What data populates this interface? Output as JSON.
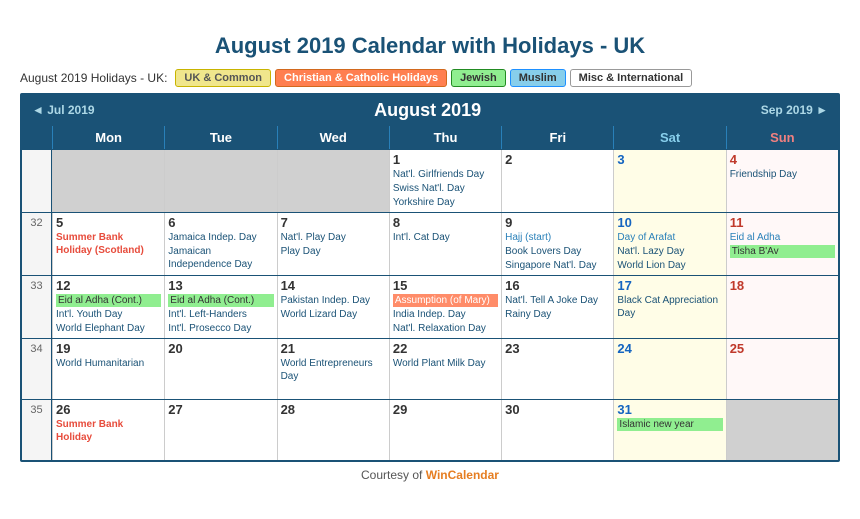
{
  "page": {
    "title": "August 2019 Calendar with Holidays - UK",
    "courtesy_text": "Courtesy of ",
    "courtesy_link": "WinCalendar"
  },
  "filters": {
    "label": "August 2019 Holidays - UK:",
    "buttons": [
      {
        "id": "uk",
        "label": "UK & Common",
        "class": "uk"
      },
      {
        "id": "christian",
        "label": "Christian & Catholic Holidays",
        "class": "christian"
      },
      {
        "id": "jewish",
        "label": "Jewish",
        "class": "jewish"
      },
      {
        "id": "muslim",
        "label": "Muslim",
        "class": "muslim"
      },
      {
        "id": "misc",
        "label": "Misc & International",
        "class": "misc"
      }
    ]
  },
  "calendar": {
    "month_title": "August 2019",
    "prev_label": "◄ Jul 2019",
    "next_label": "Sep 2019 ►",
    "day_headers": [
      "Mon",
      "Tue",
      "Wed",
      "Thu",
      "Fri",
      "Sat",
      "Sun"
    ],
    "weeks": [
      {
        "week_num": "",
        "days": [
          {
            "day": "",
            "type": "gray",
            "events": []
          },
          {
            "day": "",
            "type": "gray",
            "events": []
          },
          {
            "day": "",
            "type": "gray",
            "events": []
          },
          {
            "day": "1",
            "type": "normal",
            "events": [
              {
                "text": "Nat'l. Girlfriends Day",
                "class": "common"
              },
              {
                "text": "Swiss Nat'l. Day",
                "class": "common"
              },
              {
                "text": "Yorkshire Day",
                "class": "common"
              }
            ]
          },
          {
            "day": "2",
            "type": "normal",
            "events": []
          },
          {
            "day": "3",
            "type": "sat",
            "events": []
          },
          {
            "day": "4",
            "type": "sun",
            "events": [
              {
                "text": "Friendship Day",
                "class": "common"
              }
            ]
          }
        ]
      },
      {
        "week_num": "32",
        "days": [
          {
            "day": "5",
            "type": "normal",
            "events": [
              {
                "text": "Summer Bank Holiday (Scotland)",
                "class": "uk-bank"
              }
            ]
          },
          {
            "day": "6",
            "type": "normal",
            "events": [
              {
                "text": "Jamaica Indep. Day",
                "class": "common"
              },
              {
                "text": "Jamaican Independence Day",
                "class": "common"
              }
            ]
          },
          {
            "day": "7",
            "type": "normal",
            "events": [
              {
                "text": "Nat'l. Play Day",
                "class": "common"
              },
              {
                "text": "Play Day",
                "class": "common"
              }
            ]
          },
          {
            "day": "8",
            "type": "normal",
            "events": [
              {
                "text": "Int'l. Cat Day",
                "class": "common"
              }
            ]
          },
          {
            "day": "9",
            "type": "normal",
            "events": [
              {
                "text": "Hajj (start)",
                "class": "muslim"
              },
              {
                "text": "Book Lovers Day",
                "class": "common"
              },
              {
                "text": "Singapore Nat'l. Day",
                "class": "common"
              }
            ]
          },
          {
            "day": "10",
            "type": "sat",
            "events": [
              {
                "text": "Day of Arafat",
                "class": "muslim"
              },
              {
                "text": "Nat'l. Lazy Day",
                "class": "common"
              },
              {
                "text": "World Lion Day",
                "class": "common"
              }
            ]
          },
          {
            "day": "11",
            "type": "sun",
            "events": [
              {
                "text": "Eid al Adha",
                "class": "muslim"
              },
              {
                "text": "Tisha B'Av",
                "class": "jewish highlighted"
              }
            ]
          }
        ]
      },
      {
        "week_num": "33",
        "days": [
          {
            "day": "12",
            "type": "normal",
            "events": [
              {
                "text": "Eid al Adha (Cont.)",
                "class": "muslim highlighted"
              },
              {
                "text": "Int'l. Youth Day",
                "class": "common"
              },
              {
                "text": "World Elephant Day",
                "class": "common"
              }
            ]
          },
          {
            "day": "13",
            "type": "normal",
            "events": [
              {
                "text": "Eid al Adha (Cont.)",
                "class": "muslim highlighted"
              },
              {
                "text": "Int'l. Left-Handers",
                "class": "common"
              },
              {
                "text": "Int'l. Prosecco Day",
                "class": "common"
              }
            ]
          },
          {
            "day": "14",
            "type": "normal",
            "events": [
              {
                "text": "Pakistan Indep. Day",
                "class": "common"
              },
              {
                "text": "World Lizard Day",
                "class": "common"
              }
            ]
          },
          {
            "day": "15",
            "type": "normal",
            "events": [
              {
                "text": "Assumption (of Mary)",
                "class": "assumption"
              },
              {
                "text": "India Indep. Day",
                "class": "common"
              },
              {
                "text": "Nat'l. Relaxation Day",
                "class": "common"
              }
            ]
          },
          {
            "day": "16",
            "type": "normal",
            "events": [
              {
                "text": "Nat'l. Tell A Joke Day",
                "class": "common"
              },
              {
                "text": "Rainy Day",
                "class": "common"
              }
            ]
          },
          {
            "day": "17",
            "type": "sat",
            "events": [
              {
                "text": "Black Cat Appreciation Day",
                "class": "common"
              }
            ]
          },
          {
            "day": "18",
            "type": "sun",
            "events": []
          }
        ]
      },
      {
        "week_num": "34",
        "days": [
          {
            "day": "19",
            "type": "normal",
            "events": [
              {
                "text": "World Humanitarian",
                "class": "common"
              }
            ]
          },
          {
            "day": "20",
            "type": "normal",
            "events": []
          },
          {
            "day": "21",
            "type": "normal",
            "events": [
              {
                "text": "World Entrepreneurs Day",
                "class": "common"
              }
            ]
          },
          {
            "day": "22",
            "type": "normal",
            "events": [
              {
                "text": "World Plant Milk Day",
                "class": "common"
              }
            ]
          },
          {
            "day": "23",
            "type": "normal",
            "events": []
          },
          {
            "day": "24",
            "type": "sat",
            "events": []
          },
          {
            "day": "25",
            "type": "sun",
            "events": []
          }
        ]
      },
      {
        "week_num": "35",
        "days": [
          {
            "day": "26",
            "type": "normal",
            "events": [
              {
                "text": "Summer Bank Holiday",
                "class": "uk-bank"
              }
            ]
          },
          {
            "day": "27",
            "type": "normal",
            "events": []
          },
          {
            "day": "28",
            "type": "normal",
            "events": []
          },
          {
            "day": "29",
            "type": "normal",
            "events": []
          },
          {
            "day": "30",
            "type": "normal",
            "events": []
          },
          {
            "day": "31",
            "type": "sat",
            "events": [
              {
                "text": "Islamic new year",
                "class": "islamic-new highlighted"
              }
            ]
          },
          {
            "day": "",
            "type": "gray",
            "events": []
          }
        ]
      }
    ]
  }
}
